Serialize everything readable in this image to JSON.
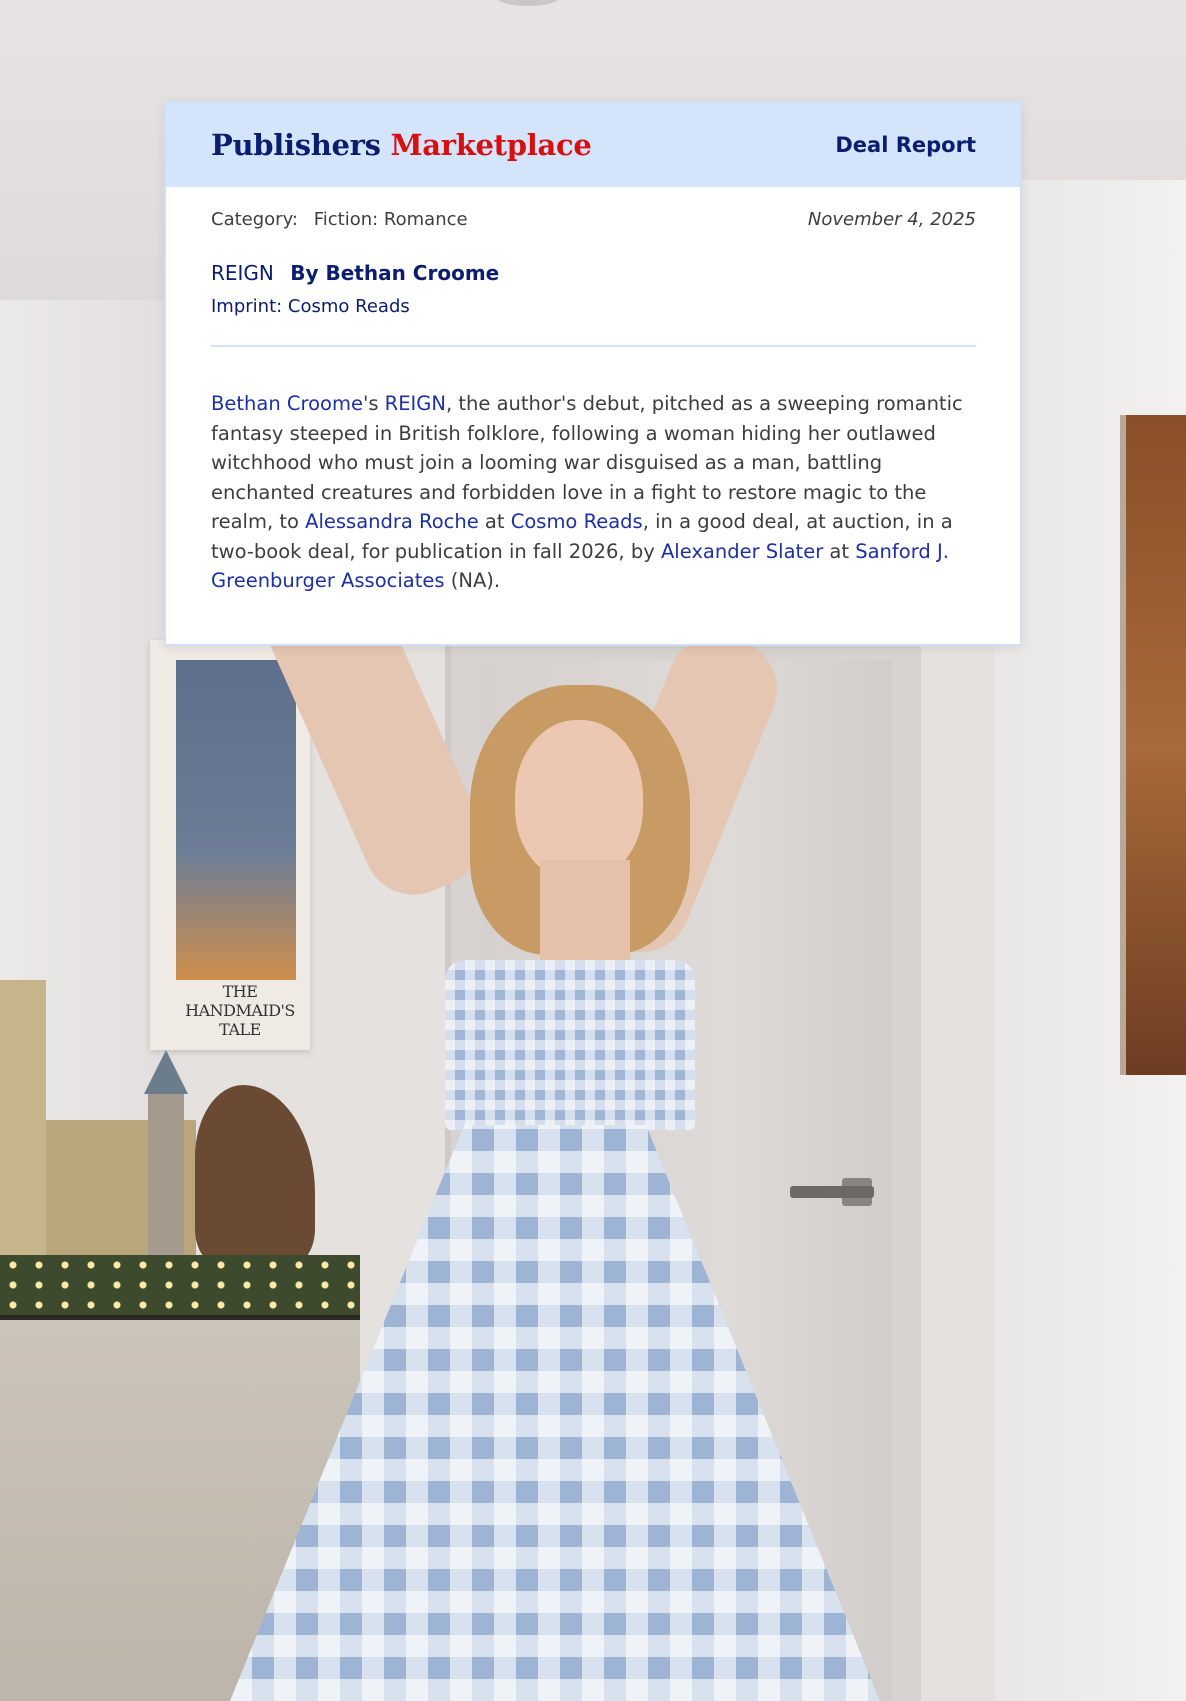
{
  "header": {
    "brand_part1": "Publishers",
    "brand_part2": "Marketplace",
    "report_label": "Deal Report"
  },
  "meta": {
    "category_label": "Category:",
    "category_value": "Fiction: Romance",
    "date": "November 4, 2025"
  },
  "book": {
    "title": "REIGN",
    "byline": "By Bethan Croome",
    "imprint": "Imprint: Cosmo Reads"
  },
  "description": {
    "author_link": "Bethan Croome",
    "t1": "'s ",
    "title_link": "REIGN",
    "t2": ", the author's debut, pitched as a sweeping romantic fantasy steeped in British folklore, following a woman hiding her outlawed witchhood who must join a looming war disguised as a man, battling enchanted creatures and forbidden love in a fight to restore magic to the realm, to ",
    "editor_link": "Alessandra Roche",
    "t3": " at ",
    "publisher_link": "Cosmo Reads",
    "t4": ", in a good deal, at auction, in a two-book deal, for publication in fall 2026, by ",
    "agent_link": "Alexander Slater",
    "t5": " at ",
    "agency_link": "Sanford J. Greenburger Associates",
    "t6": " (NA)."
  },
  "background": {
    "poster_caption": "THE HANDMAID'S TALE"
  },
  "colors": {
    "header_bg": "#d4e4fb",
    "brand_navy": "#0b1d6e",
    "brand_red": "#d80f0f",
    "link_blue": "#1d2fa4"
  }
}
